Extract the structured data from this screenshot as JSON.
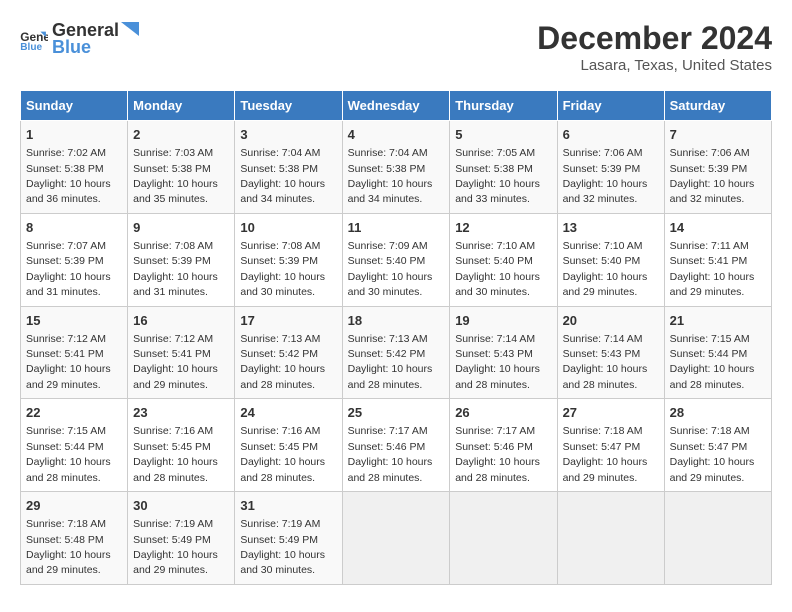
{
  "logo": {
    "text_general": "General",
    "text_blue": "Blue"
  },
  "header": {
    "month_title": "December 2024",
    "location": "Lasara, Texas, United States"
  },
  "weekdays": [
    "Sunday",
    "Monday",
    "Tuesday",
    "Wednesday",
    "Thursday",
    "Friday",
    "Saturday"
  ],
  "weeks": [
    [
      {
        "day": "1",
        "sunrise": "7:02 AM",
        "sunset": "5:38 PM",
        "daylight": "10 hours and 36 minutes."
      },
      {
        "day": "2",
        "sunrise": "7:03 AM",
        "sunset": "5:38 PM",
        "daylight": "10 hours and 35 minutes."
      },
      {
        "day": "3",
        "sunrise": "7:04 AM",
        "sunset": "5:38 PM",
        "daylight": "10 hours and 34 minutes."
      },
      {
        "day": "4",
        "sunrise": "7:04 AM",
        "sunset": "5:38 PM",
        "daylight": "10 hours and 34 minutes."
      },
      {
        "day": "5",
        "sunrise": "7:05 AM",
        "sunset": "5:38 PM",
        "daylight": "10 hours and 33 minutes."
      },
      {
        "day": "6",
        "sunrise": "7:06 AM",
        "sunset": "5:39 PM",
        "daylight": "10 hours and 32 minutes."
      },
      {
        "day": "7",
        "sunrise": "7:06 AM",
        "sunset": "5:39 PM",
        "daylight": "10 hours and 32 minutes."
      }
    ],
    [
      {
        "day": "8",
        "sunrise": "7:07 AM",
        "sunset": "5:39 PM",
        "daylight": "10 hours and 31 minutes."
      },
      {
        "day": "9",
        "sunrise": "7:08 AM",
        "sunset": "5:39 PM",
        "daylight": "10 hours and 31 minutes."
      },
      {
        "day": "10",
        "sunrise": "7:08 AM",
        "sunset": "5:39 PM",
        "daylight": "10 hours and 30 minutes."
      },
      {
        "day": "11",
        "sunrise": "7:09 AM",
        "sunset": "5:40 PM",
        "daylight": "10 hours and 30 minutes."
      },
      {
        "day": "12",
        "sunrise": "7:10 AM",
        "sunset": "5:40 PM",
        "daylight": "10 hours and 30 minutes."
      },
      {
        "day": "13",
        "sunrise": "7:10 AM",
        "sunset": "5:40 PM",
        "daylight": "10 hours and 29 minutes."
      },
      {
        "day": "14",
        "sunrise": "7:11 AM",
        "sunset": "5:41 PM",
        "daylight": "10 hours and 29 minutes."
      }
    ],
    [
      {
        "day": "15",
        "sunrise": "7:12 AM",
        "sunset": "5:41 PM",
        "daylight": "10 hours and 29 minutes."
      },
      {
        "day": "16",
        "sunrise": "7:12 AM",
        "sunset": "5:41 PM",
        "daylight": "10 hours and 29 minutes."
      },
      {
        "day": "17",
        "sunrise": "7:13 AM",
        "sunset": "5:42 PM",
        "daylight": "10 hours and 28 minutes."
      },
      {
        "day": "18",
        "sunrise": "7:13 AM",
        "sunset": "5:42 PM",
        "daylight": "10 hours and 28 minutes."
      },
      {
        "day": "19",
        "sunrise": "7:14 AM",
        "sunset": "5:43 PM",
        "daylight": "10 hours and 28 minutes."
      },
      {
        "day": "20",
        "sunrise": "7:14 AM",
        "sunset": "5:43 PM",
        "daylight": "10 hours and 28 minutes."
      },
      {
        "day": "21",
        "sunrise": "7:15 AM",
        "sunset": "5:44 PM",
        "daylight": "10 hours and 28 minutes."
      }
    ],
    [
      {
        "day": "22",
        "sunrise": "7:15 AM",
        "sunset": "5:44 PM",
        "daylight": "10 hours and 28 minutes."
      },
      {
        "day": "23",
        "sunrise": "7:16 AM",
        "sunset": "5:45 PM",
        "daylight": "10 hours and 28 minutes."
      },
      {
        "day": "24",
        "sunrise": "7:16 AM",
        "sunset": "5:45 PM",
        "daylight": "10 hours and 28 minutes."
      },
      {
        "day": "25",
        "sunrise": "7:17 AM",
        "sunset": "5:46 PM",
        "daylight": "10 hours and 28 minutes."
      },
      {
        "day": "26",
        "sunrise": "7:17 AM",
        "sunset": "5:46 PM",
        "daylight": "10 hours and 28 minutes."
      },
      {
        "day": "27",
        "sunrise": "7:18 AM",
        "sunset": "5:47 PM",
        "daylight": "10 hours and 29 minutes."
      },
      {
        "day": "28",
        "sunrise": "7:18 AM",
        "sunset": "5:47 PM",
        "daylight": "10 hours and 29 minutes."
      }
    ],
    [
      {
        "day": "29",
        "sunrise": "7:18 AM",
        "sunset": "5:48 PM",
        "daylight": "10 hours and 29 minutes."
      },
      {
        "day": "30",
        "sunrise": "7:19 AM",
        "sunset": "5:49 PM",
        "daylight": "10 hours and 29 minutes."
      },
      {
        "day": "31",
        "sunrise": "7:19 AM",
        "sunset": "5:49 PM",
        "daylight": "10 hours and 30 minutes."
      },
      null,
      null,
      null,
      null
    ]
  ]
}
